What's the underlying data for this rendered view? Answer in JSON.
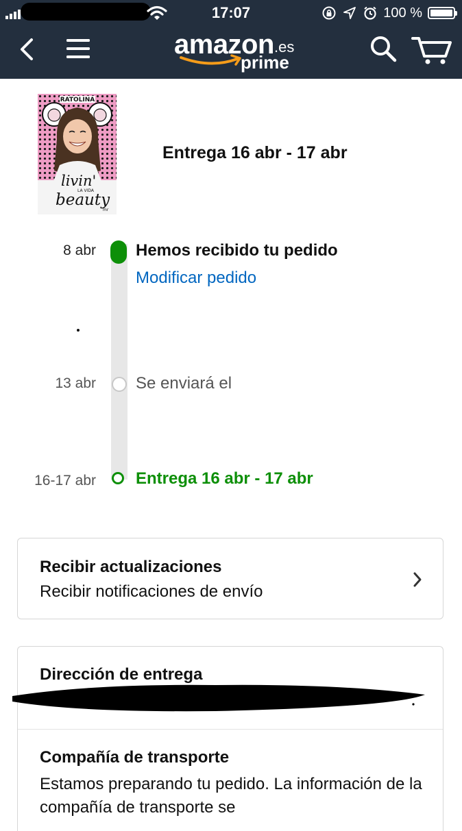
{
  "status_bar": {
    "time": "17:07",
    "battery": "100 %"
  },
  "nav": {
    "logo_word": "amazon",
    "logo_tld": ".es",
    "logo_sub": "prime",
    "icons": [
      "back-arrow-icon",
      "menu-icon",
      "search-icon",
      "cart-icon"
    ]
  },
  "product": {
    "cover_series": "RATOLINA",
    "cover_title_1": "livin'",
    "cover_title_2": "LA VIDA",
    "cover_title_3": "beauty",
    "cover_publisher": "mr",
    "delivery_heading": "Entrega 16 abr - 17 abr"
  },
  "timeline": {
    "steps": [
      {
        "date": "8 abr",
        "title": "Hemos recibido tu pedido",
        "link": "Modificar pedido",
        "state": "done"
      },
      {
        "date": "13 abr",
        "title": "Se enviará el",
        "state": "pending"
      },
      {
        "date": "16-17 abr",
        "title": "Entrega 16 abr - 17 abr",
        "state": "delivery"
      }
    ]
  },
  "updates_card": {
    "title": "Recibir actualizaciones",
    "subtitle": "Recibir notificaciones de envío"
  },
  "address_card": {
    "title": "Dirección de entrega"
  },
  "carrier_card": {
    "title": "Compañía de transporte",
    "text": "Estamos preparando tu pedido. La información de la compañía de transporte se"
  },
  "colors": {
    "header_bg": "#232f3e",
    "accent_green": "#0d8f08",
    "link_blue": "#0066c0",
    "smile_orange": "#f59c1a",
    "cover_pink": "#ee9cc4"
  }
}
